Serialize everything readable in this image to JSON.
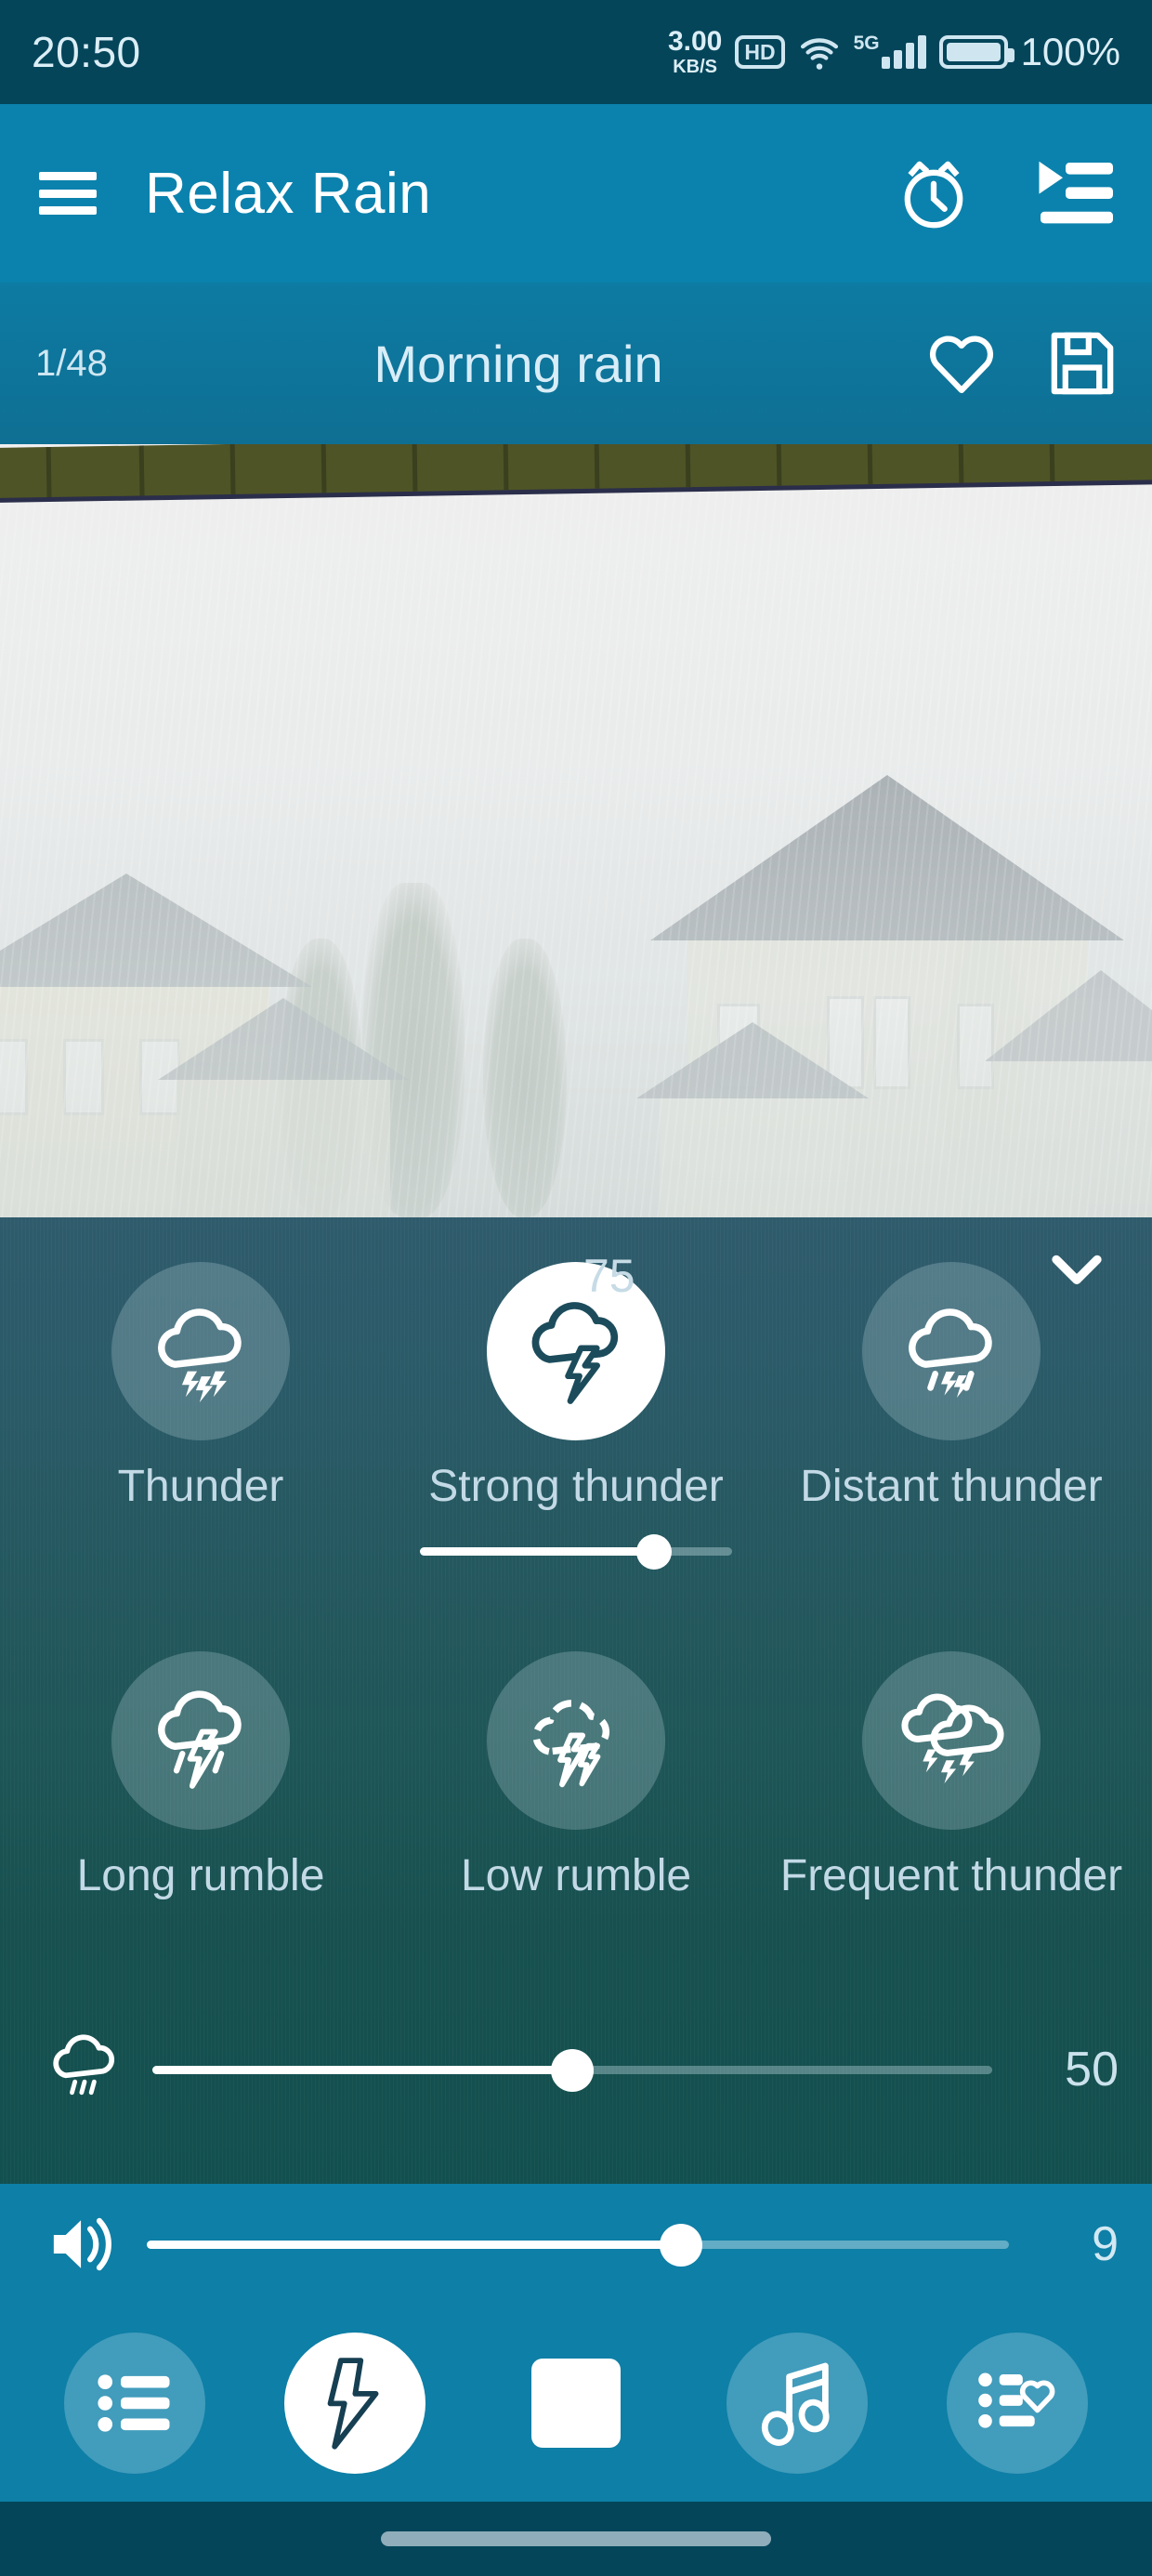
{
  "status_bar": {
    "time": "20:50",
    "net_speed_value": "3.00",
    "net_speed_unit": "KB/S",
    "hd_badge": "HD",
    "network_type": "5G",
    "battery_percent": "100%",
    "icons": [
      "wifi-icon",
      "signal-bars-icon",
      "battery-icon"
    ]
  },
  "app_bar": {
    "title": "Relax Rain",
    "menu_icon": "hamburger-menu-icon",
    "alarm_icon": "alarm-clock-icon",
    "playlist_icon": "playlist-play-icon",
    "background": "#0b82ad"
  },
  "track_bar": {
    "index": "1/48",
    "title": "Morning rain",
    "favorite_icon": "heart-outline-icon",
    "save_icon": "floppy-save-icon"
  },
  "sound_panel": {
    "collapse_icon": "chevron-down-icon",
    "sounds": [
      {
        "label": "Thunder",
        "icon": "cloud-triple-bolt-icon",
        "active": false,
        "value": null
      },
      {
        "label": "Strong thunder",
        "icon": "cloud-strong-bolt-icon",
        "active": true,
        "value": "75"
      },
      {
        "label": "Distant thunder",
        "icon": "cloud-rain-bolt-icon",
        "active": false,
        "value": null
      },
      {
        "label": "Long rumble",
        "icon": "cloud-long-bolt-icon",
        "active": false,
        "value": null
      },
      {
        "label": "Low rumble",
        "icon": "cloud-double-bolt-icon",
        "active": false,
        "value": null
      },
      {
        "label": "Frequent thunder",
        "icon": "clouds-multi-bolt-icon",
        "active": false,
        "value": null
      }
    ],
    "active_slider_percent": 75,
    "rain_slider": {
      "icon": "rain-cloud-icon",
      "value": "50",
      "percent": 50
    }
  },
  "volume_bar": {
    "icon": "speaker-volume-icon",
    "value": "9",
    "percent": 62
  },
  "bottom_nav": [
    {
      "name": "sound-list-button",
      "icon": "list-bullets-icon",
      "active": false
    },
    {
      "name": "thunder-button",
      "icon": "lightning-bolt-icon",
      "active": true
    },
    {
      "name": "stop-button",
      "icon": "stop-square-icon",
      "active": false
    },
    {
      "name": "music-button",
      "icon": "music-note-icon",
      "active": false
    },
    {
      "name": "favorites-button",
      "icon": "list-heart-icon",
      "active": false
    }
  ],
  "colors": {
    "status_bar_bg": "#04455a",
    "app_bar_bg": "#0b82ad",
    "track_bar_bg": "#0f7398",
    "panel_top": "#2f5b6c",
    "panel_bottom": "#12504f",
    "accent_white": "#ffffff",
    "text_light": "#c6dbe6"
  }
}
